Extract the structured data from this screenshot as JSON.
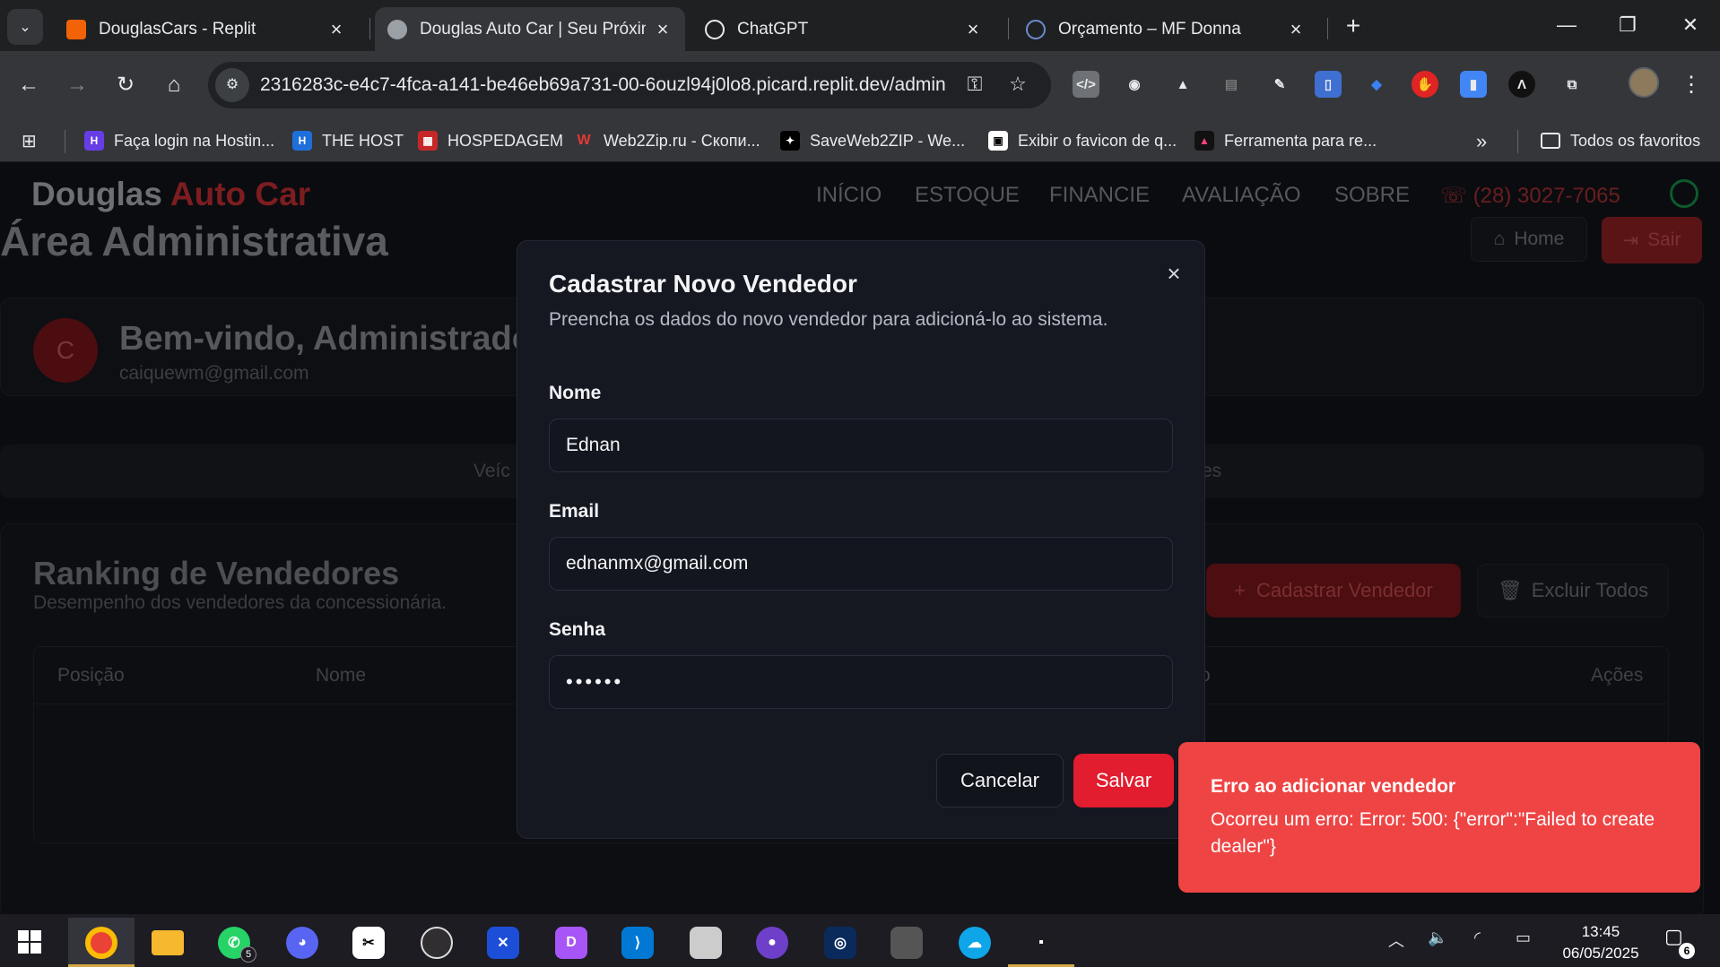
{
  "browser": {
    "tabs": [
      {
        "title": "DouglasCars - Replit",
        "active": false
      },
      {
        "title": "Douglas Auto Car | Seu Próximo",
        "active": true
      },
      {
        "title": "ChatGPT",
        "active": false
      },
      {
        "title": "Orçamento – MF Donna",
        "active": false
      }
    ],
    "url": "2316283c-e4c7-4fca-a141-be46eb69a731-00-6ouzl94j0lo8.picard.replit.dev/admin",
    "bookmarks": [
      {
        "label": "Faça login na Hostin...",
        "color": "#673de6",
        "icon": "hostinger-icon"
      },
      {
        "label": "THE HOST",
        "color": "#1e6fd9",
        "icon": "thehost-icon"
      },
      {
        "label": "HOSPEDAGEM",
        "color": "#c62828",
        "icon": "hospedagem-icon"
      },
      {
        "label": "Web2Zip.ru - Скопи...",
        "color": "#d32f2f",
        "icon": "web2zip-icon"
      },
      {
        "label": "SaveWeb2ZIP - We...",
        "color": "#222222",
        "icon": "saveweb2zip-icon"
      },
      {
        "label": "Exibir o favicon de q...",
        "color": "#ffffff",
        "icon": "favicon-icon"
      },
      {
        "label": "Ferramenta para re...",
        "color": "#6a1b9a",
        "icon": "ferramenta-icon"
      }
    ],
    "all_bookmarks": "Todos os favoritos"
  },
  "site": {
    "brand_main": "Douglas",
    "brand_accent": "Auto Car",
    "nav": [
      "INÍCIO",
      "ESTOQUE",
      "FINANCIE",
      "AVALIAÇÃO",
      "SOBRE"
    ],
    "phone": "(28) 3027-7065",
    "admin_title": "Área Administrativa",
    "home_label": "Home",
    "logout_label": "Sair",
    "avatar_letter": "C",
    "welcome_title": "Bem-vindo, Administrador",
    "welcome_email": "caiquewm@gmail.com",
    "tabs_fragment_left": "Veíc",
    "tabs_fragment_right": "es",
    "ranking_title": "Ranking de Vendedores",
    "ranking_subtitle": "Desempenho dos vendedores da concessionária.",
    "add_seller_label": "Cadastrar Vendedor",
    "delete_all_label": "Excluir Todos",
    "table_headers": [
      "Posição",
      "Nome",
      "o",
      "Ações"
    ]
  },
  "modal": {
    "title": "Cadastrar Novo Vendedor",
    "description": "Preencha os dados do novo vendedor para adicioná-lo ao sistema.",
    "name_label": "Nome",
    "name_value": "Ednan",
    "email_label": "Email",
    "email_value": "ednanmx@gmail.com",
    "password_label": "Senha",
    "password_value": "••••••",
    "cancel_label": "Cancelar",
    "save_label": "Salvar",
    "close_icon": "×"
  },
  "toast": {
    "title": "Erro ao adicionar vendedor",
    "message": "Ocorreu um erro: Error: 500: {\"error\":\"Failed to create dealer\"}",
    "color": "#ef4444"
  },
  "taskbar": {
    "whatsapp_badge": "5",
    "time": "13:45",
    "date": "06/05/2025",
    "notification_count": "6"
  },
  "colors": {
    "brand_red": "#e11d2f",
    "modal_bg": "#151821",
    "page_bg": "#0b0c10"
  }
}
